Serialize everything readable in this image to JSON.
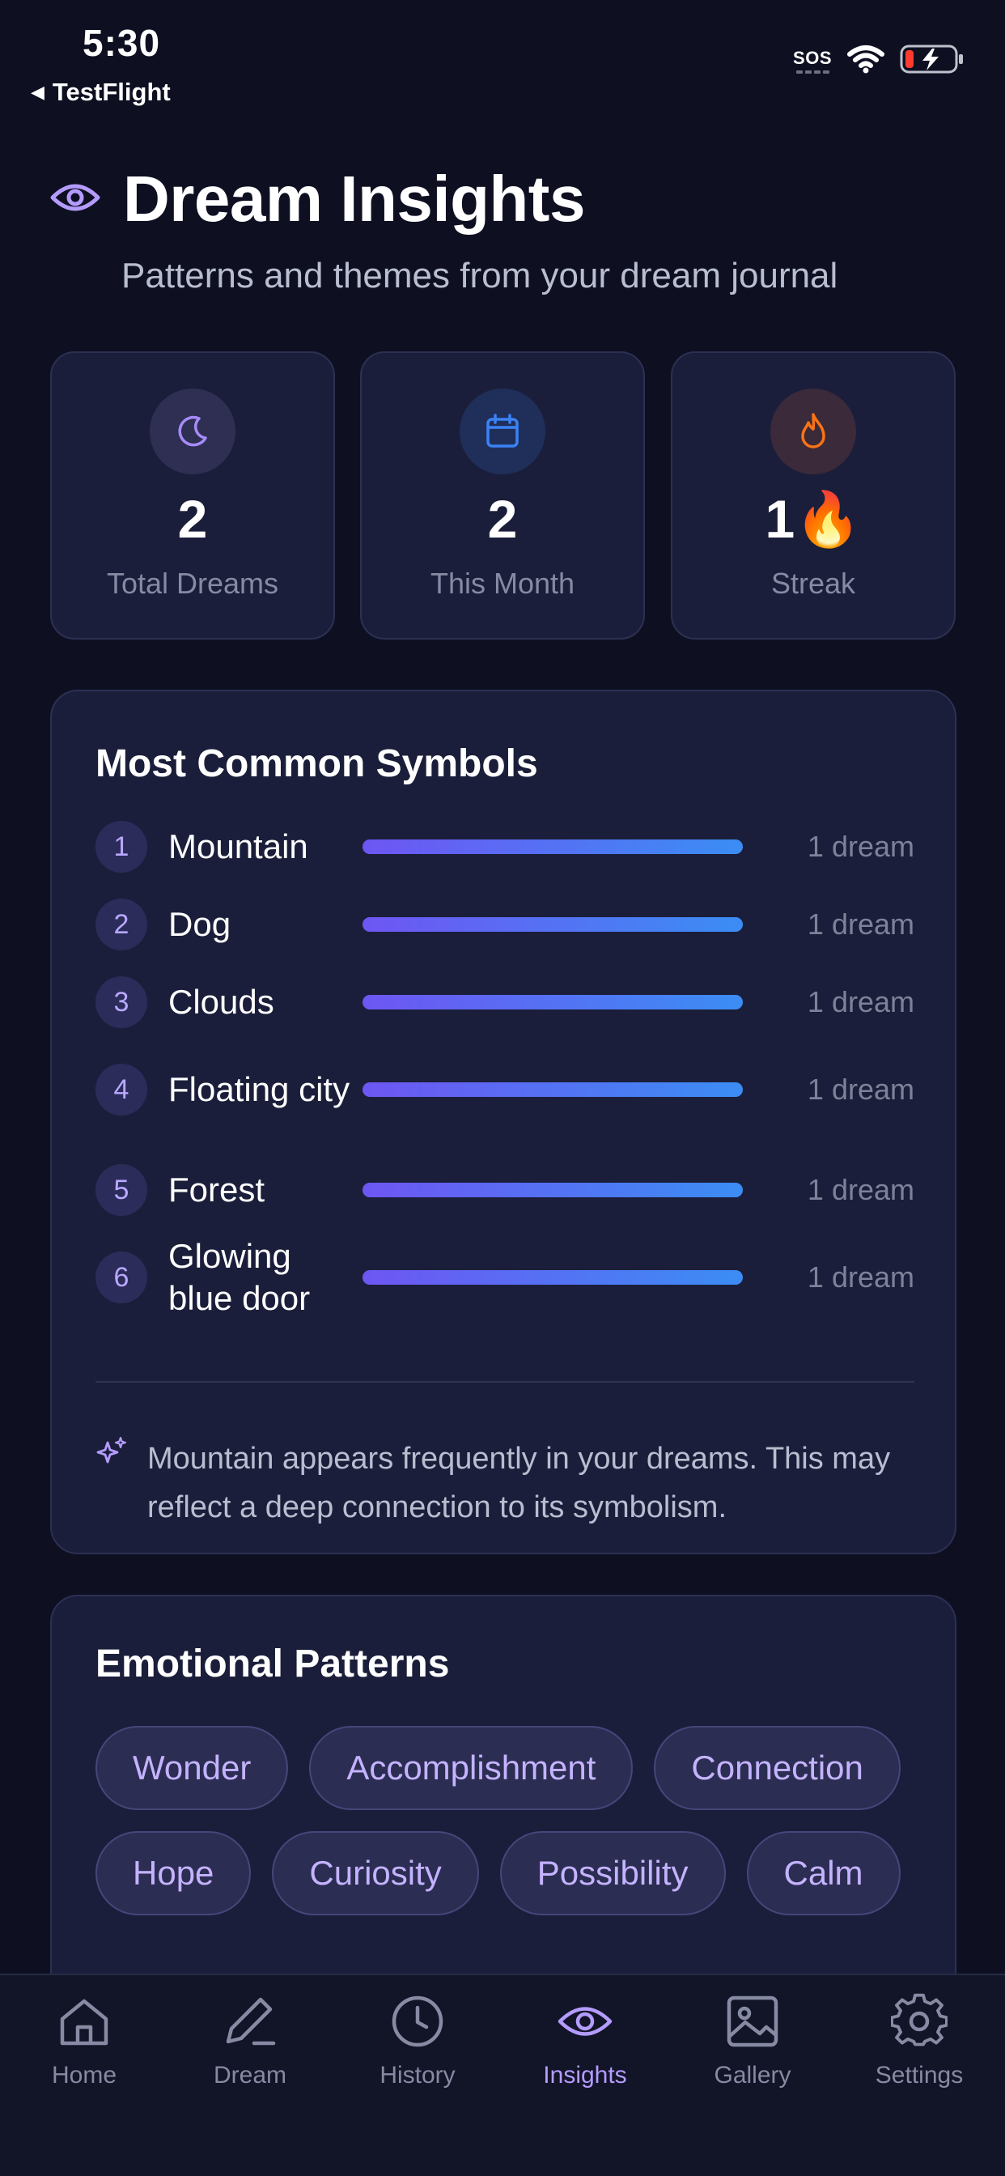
{
  "status_bar": {
    "time": "5:30",
    "back_app": "TestFlight",
    "sos": "SOS"
  },
  "header": {
    "title": "Dream Insights",
    "subtitle": "Patterns and themes from your dream journal",
    "icon": "eye-icon"
  },
  "stats": [
    {
      "value": "2",
      "label": "Total Dreams",
      "icon": "moon-icon",
      "accent": "#a78bfa"
    },
    {
      "value": "2",
      "label": "This Month",
      "icon": "calendar-icon",
      "accent": "#3b82f6"
    },
    {
      "value": "1🔥",
      "label": "Streak",
      "icon": "flame-icon",
      "accent": "#f97316"
    }
  ],
  "symbols": {
    "title": "Most Common Symbols",
    "items": [
      {
        "rank": "1",
        "name": "Mountain",
        "count": "1 dream",
        "fill": 1.0
      },
      {
        "rank": "2",
        "name": "Dog",
        "count": "1 dream",
        "fill": 1.0
      },
      {
        "rank": "3",
        "name": "Clouds",
        "count": "1 dream",
        "fill": 1.0
      },
      {
        "rank": "4",
        "name": "Floating city",
        "count": "1 dream",
        "fill": 1.0
      },
      {
        "rank": "5",
        "name": "Forest",
        "count": "1 dream",
        "fill": 1.0
      },
      {
        "rank": "6",
        "name": "Glowing blue door",
        "count": "1 dream",
        "fill": 1.0
      }
    ],
    "insight": "Mountain appears frequently in your dreams. This may reflect a deep connection to its symbolism."
  },
  "emotions": {
    "title": "Emotional Patterns",
    "chips": [
      "Wonder",
      "Accomplishment",
      "Connection",
      "Hope",
      "Curiosity",
      "Possibility",
      "Calm"
    ]
  },
  "tabs": [
    {
      "label": "Home",
      "icon": "home-icon",
      "active": false
    },
    {
      "label": "Dream",
      "icon": "pen-icon",
      "active": false
    },
    {
      "label": "History",
      "icon": "clock-icon",
      "active": false
    },
    {
      "label": "Insights",
      "icon": "eye-icon",
      "active": true
    },
    {
      "label": "Gallery",
      "icon": "image-icon",
      "active": false
    },
    {
      "label": "Settings",
      "icon": "gear-icon",
      "active": false
    }
  ],
  "colors": {
    "background": "#0e1022",
    "card": "#1b1e3a",
    "accent": "#b49cff",
    "bar_start": "#6e56f3",
    "bar_end": "#3b8df4"
  }
}
